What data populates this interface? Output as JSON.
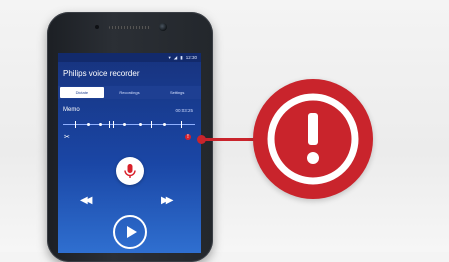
{
  "status": {
    "time": "12:30"
  },
  "app": {
    "title": "Philips voice recorder"
  },
  "tabs": [
    {
      "label": "Dictate",
      "active": true
    },
    {
      "label": "Recordings",
      "active": false
    },
    {
      "label": "Settings",
      "active": false
    }
  ],
  "recording": {
    "name": "Memo",
    "time": "00:03:25",
    "alert_marker": "!"
  },
  "icons": {
    "cut": "scissors-icon",
    "record": "microphone-icon",
    "rewind": "rewind-icon",
    "fast_forward": "fast-forward-icon",
    "play": "play-icon",
    "warning": "exclamation-icon"
  },
  "colors": {
    "screen_top": "#17337e",
    "screen_bottom": "#2f6fd0",
    "alert_red": "#c9242c",
    "mic_red": "#d8202a"
  }
}
